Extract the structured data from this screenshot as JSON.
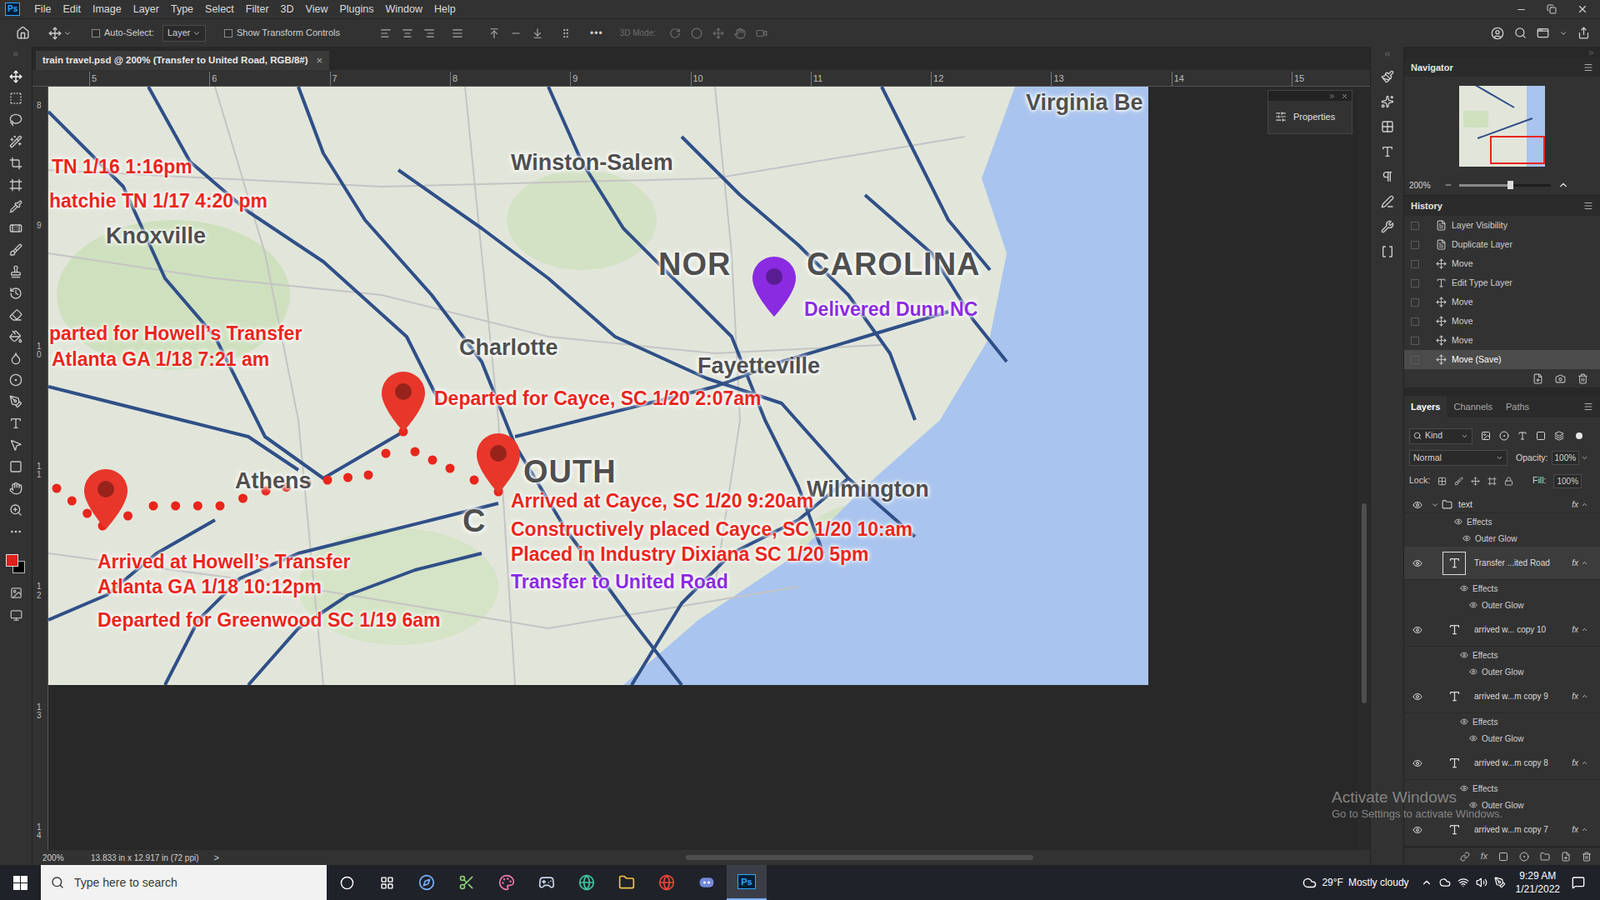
{
  "app": {
    "icon": "Ps"
  },
  "menu": [
    "File",
    "Edit",
    "Image",
    "Layer",
    "Type",
    "Select",
    "Filter",
    "3D",
    "View",
    "Plugins",
    "Window",
    "Help"
  ],
  "options_bar": {
    "auto_select": {
      "label": "Auto-Select:",
      "checked": false
    },
    "target": "Layer",
    "show_transform_controls": {
      "label": "Show Transform Controls",
      "checked": false
    },
    "more": "•••",
    "mode_3d": "3D Mode:"
  },
  "document_tab": {
    "title": "train travel.psd @ 200% (Transfer to United Road, RGB/8#)",
    "close": "×"
  },
  "rulers": {
    "top": [
      "5",
      "6",
      "7",
      "8",
      "9",
      "10",
      "11",
      "12",
      "13",
      "14",
      "15"
    ],
    "left": [
      "8",
      "9",
      "10",
      "11",
      "12",
      "13",
      "14"
    ]
  },
  "colors": {
    "foreground": "#e0201b",
    "background": "#000000"
  },
  "canvas": {
    "map_labels": [
      {
        "text": "Virginia Be",
        "size": "small"
      },
      {
        "text": "Winston-Salem",
        "size": "small"
      },
      {
        "text": "Knoxville",
        "size": "small"
      },
      {
        "text": "NOR",
        "size": "large"
      },
      {
        "text": "CAROLINA",
        "size": "large"
      },
      {
        "text": "Charlotte",
        "size": "small"
      },
      {
        "text": "Fayetteville",
        "size": "small"
      },
      {
        "text": "Athens",
        "size": "small"
      },
      {
        "text": "OUTH",
        "size": "large"
      },
      {
        "text": "C",
        "size": "large"
      },
      {
        "text": "Wilmington",
        "size": "small"
      }
    ],
    "annotations": [
      {
        "text": "TN 1/16 1:16pm",
        "color": "#e8261c"
      },
      {
        "text": "hatchie TN 1/17 4:20 pm",
        "color": "#e8261c"
      },
      {
        "text": "parted for Howell’s Transfer",
        "color": "#e8261c"
      },
      {
        "text": "Atlanta GA 1/18 7:21 am",
        "color": "#e8261c"
      },
      {
        "text": "Departed for Cayce, SC 1/20 2:07am",
        "color": "#e8261c"
      },
      {
        "text": "Arrived at Howell’s Transfer",
        "color": "#e8261c"
      },
      {
        "text": "Atlanta GA 1/18 10:12pm",
        "color": "#e8261c"
      },
      {
        "text": "Departed for Greenwood SC 1/19 6am",
        "color": "#e8261c"
      },
      {
        "text": "Arrived at Cayce, SC 1/20 9:20am",
        "color": "#e8261c"
      },
      {
        "text": "Constructively placed Cayce, SC 1/20 10:am",
        "color": "#e8261c"
      },
      {
        "text": "Placed in Industry Dixiana SC 1/20 5pm",
        "color": "#e8261c"
      },
      {
        "text": "Transfer to United Road",
        "color": "#8b2be0"
      },
      {
        "text": "Delivered Dunn NC",
        "color": "#8b2be0"
      }
    ],
    "pins": [
      {
        "color": "#e8362a"
      },
      {
        "color": "#e8362a"
      },
      {
        "color": "#e8362a"
      },
      {
        "color": "#8a2be2"
      }
    ],
    "route_color": "#e8261c"
  },
  "properties_panel": {
    "label": "Properties"
  },
  "navigator": {
    "title": "Navigator",
    "zoom": "200%",
    "level": 0.55
  },
  "history": {
    "title": "History",
    "items": [
      {
        "label": "Layer Visibility",
        "kind": "layer",
        "selected": false
      },
      {
        "label": "Duplicate Layer",
        "kind": "layer",
        "selected": false
      },
      {
        "label": "Move",
        "kind": "move",
        "selected": false
      },
      {
        "label": "Edit Type Layer",
        "kind": "type",
        "selected": false
      },
      {
        "label": "Move",
        "kind": "move",
        "selected": false
      },
      {
        "label": "Move",
        "kind": "move",
        "selected": false
      },
      {
        "label": "Move",
        "kind": "move",
        "selected": false
      },
      {
        "label": "Move (Save)",
        "kind": "move",
        "selected": true
      }
    ]
  },
  "layers_panel": {
    "tabs": [
      {
        "label": "Layers",
        "selected": true
      },
      {
        "label": "Channels",
        "selected": false
      },
      {
        "label": "Paths",
        "selected": false
      }
    ],
    "filter": "Kind",
    "blend_mode": "Normal",
    "opacity_label": "Opacity:",
    "opacity": "100%",
    "lock_label": "Lock:",
    "fill_label": "Fill:",
    "fill": "100%",
    "footer_fx": "fx",
    "layers": [
      {
        "name": "text",
        "kind": "group",
        "visible": true,
        "selected": false,
        "expanded": true,
        "fx": "fx",
        "effects": [
          "Effects",
          "Outer Glow"
        ]
      },
      {
        "name": "Transfer ...ited Road",
        "kind": "type",
        "visible": true,
        "selected": true,
        "expanded": true,
        "fx": "fx",
        "effects": [
          "Effects",
          "Outer Glow"
        ]
      },
      {
        "name": "arrived w... copy 10",
        "kind": "type",
        "visible": true,
        "selected": false,
        "expanded": true,
        "fx": "fx",
        "effects": [
          "Effects",
          "Outer Glow"
        ]
      },
      {
        "name": "arrived w...m copy 9",
        "kind": "type",
        "visible": true,
        "selected": false,
        "expanded": true,
        "fx": "fx",
        "effects": [
          "Effects",
          "Outer Glow"
        ]
      },
      {
        "name": "arrived w...m copy 8",
        "kind": "type",
        "visible": true,
        "selected": false,
        "expanded": true,
        "fx": "fx",
        "effects": [
          "Effects",
          "Outer Glow"
        ]
      },
      {
        "name": "arrived w...m copy 7",
        "kind": "type",
        "visible": true,
        "selected": false,
        "expanded": false,
        "fx": "fx",
        "effects": []
      }
    ]
  },
  "status_bar": {
    "zoom": "200%",
    "size": "13.833 in x 12.917 in (72 ppi)",
    "arrow": ">"
  },
  "watermark": {
    "title": "Activate Windows",
    "subtitle": "Go to Settings to activate Windows."
  },
  "taskbar": {
    "search_placeholder": "Type here to search",
    "active_app": "Ps",
    "temperature": "29°F",
    "weather": "Mostly cloudy",
    "time": "9:29 AM",
    "date": "1/21/2022"
  }
}
